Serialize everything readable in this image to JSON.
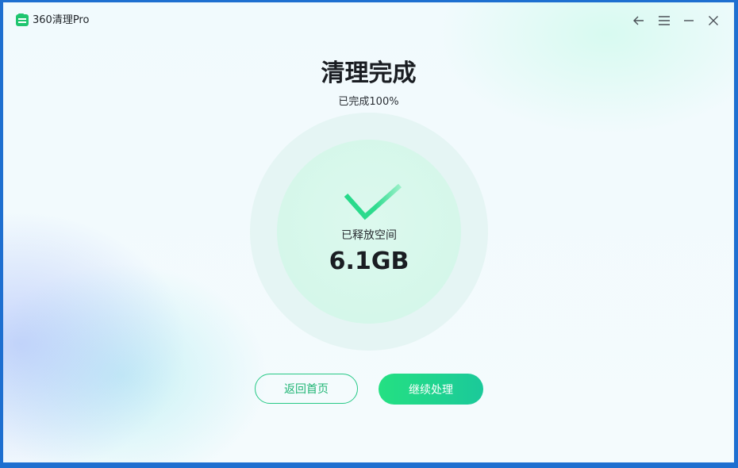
{
  "app": {
    "title": "360清理Pro",
    "logo_icon": "app-logo-icon"
  },
  "window_controls": {
    "back_icon": "arrow-left-icon",
    "menu_icon": "hamburger-menu-icon",
    "minimize_icon": "minimize-icon",
    "close_icon": "close-icon"
  },
  "main": {
    "headline": "清理完成",
    "progress_text": "已完成100%",
    "freed_label": "已释放空间",
    "freed_value": "6.1GB",
    "check_icon": "checkmark-icon"
  },
  "actions": {
    "home_label": "返回首页",
    "continue_label": "继续处理"
  },
  "colors": {
    "accent": "#24e082",
    "accent_dark": "#1bc99a",
    "outline_text": "#20b574"
  }
}
